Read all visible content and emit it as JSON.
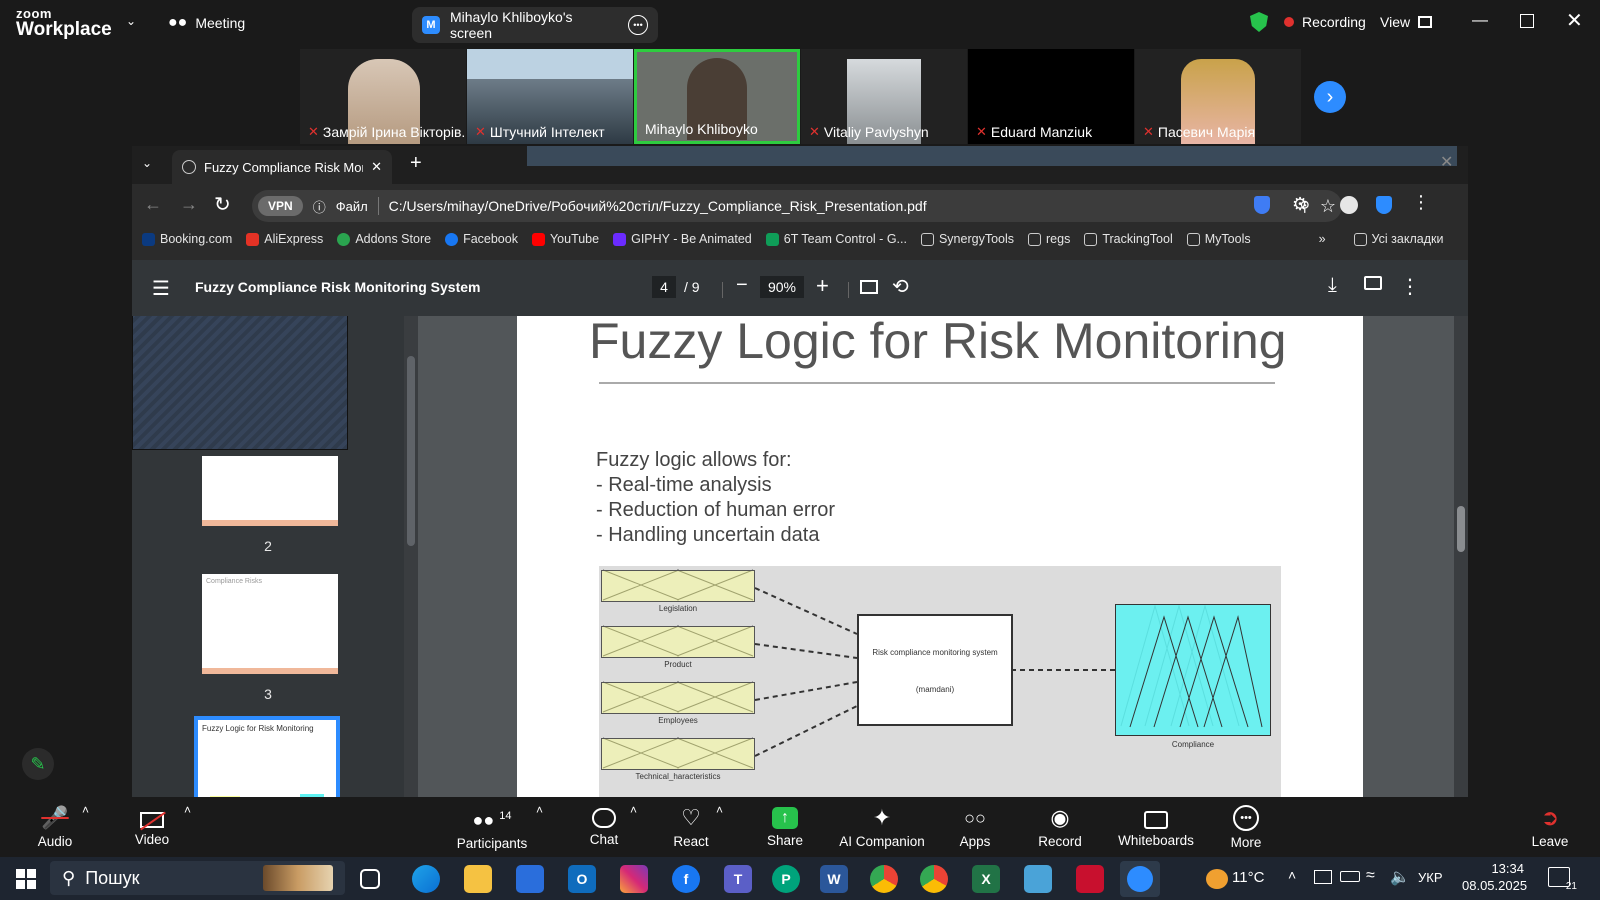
{
  "zoom": {
    "brand_top": "zoom",
    "brand_bottom": "Workplace",
    "meeting_label": "Meeting",
    "screen_share_label": "Mihaylo Khliboyko's screen",
    "recording_label": "Recording",
    "view_label": "View",
    "participants": [
      {
        "name": "Замрій Ірина Вікторів..."
      },
      {
        "name": "Штучний Інтелект"
      },
      {
        "name": "Mihaylo Khliboyko"
      },
      {
        "name": "Vitaliy Pavlyshyn"
      },
      {
        "name": "Eduard Manziuk"
      },
      {
        "name": "Пасевич Марія"
      }
    ],
    "toolbar": {
      "audio": "Audio",
      "video": "Video",
      "participants": "Participants",
      "participants_count": "14",
      "chat": "Chat",
      "react": "React",
      "share": "Share",
      "ai_companion": "AI Companion",
      "apps": "Apps",
      "record": "Record",
      "whiteboards": "Whiteboards",
      "more": "More",
      "leave": "Leave"
    }
  },
  "browser": {
    "tab_title": "Fuzzy Compliance Risk Monitor",
    "vpn_label": "VPN",
    "file_label": "Файл",
    "url": "C:/Users/mihay/OneDrive/Робочий%20стіл/Fuzzy_Compliance_Risk_Presentation.pdf",
    "bookmarks": [
      "Booking.com",
      "AliExpress",
      "Addons Store",
      "Facebook",
      "YouTube",
      "GIPHY - Be Animated",
      "6T Team Control - G...",
      "SynergyTools",
      "regs",
      "TrackingTool",
      "MyTools"
    ],
    "all_bookmarks": "Усі закладки"
  },
  "pdf": {
    "doc_title": "Fuzzy Compliance Risk Monitoring System",
    "current_page": "4",
    "total_pages": "/ 9",
    "zoom": "90%",
    "thumb_numbers": [
      "2",
      "3"
    ],
    "thumb3_title": "Compliance Risks",
    "thumb4_title": "Fuzzy Logic for Risk Monitoring",
    "slide": {
      "title": "Fuzzy Logic for Risk Monitoring",
      "intro": "Fuzzy logic allows for:",
      "bullets": [
        "- Real-time analysis",
        "- Reduction of human error",
        "- Handling uncertain data"
      ],
      "inputs": [
        "Legislation",
        "Product",
        "Employees",
        "Technical_haracteristics"
      ],
      "system_line1": "Risk compliance monitoring system",
      "system_line2": "(mamdani)",
      "output": "Compliance"
    }
  },
  "taskbar": {
    "search_label": "Пошук",
    "weather": "11°C",
    "language": "УКР",
    "time": "13:34",
    "date": "08.05.2025",
    "notif_count": "21"
  },
  "colors": {
    "zoom_blue": "#2D8CFF",
    "active_speaker": "#2ecc40",
    "recording": "#e0312e",
    "fuzzy_input": "#fbff9e",
    "fuzzy_output": "#5ff2f2"
  }
}
